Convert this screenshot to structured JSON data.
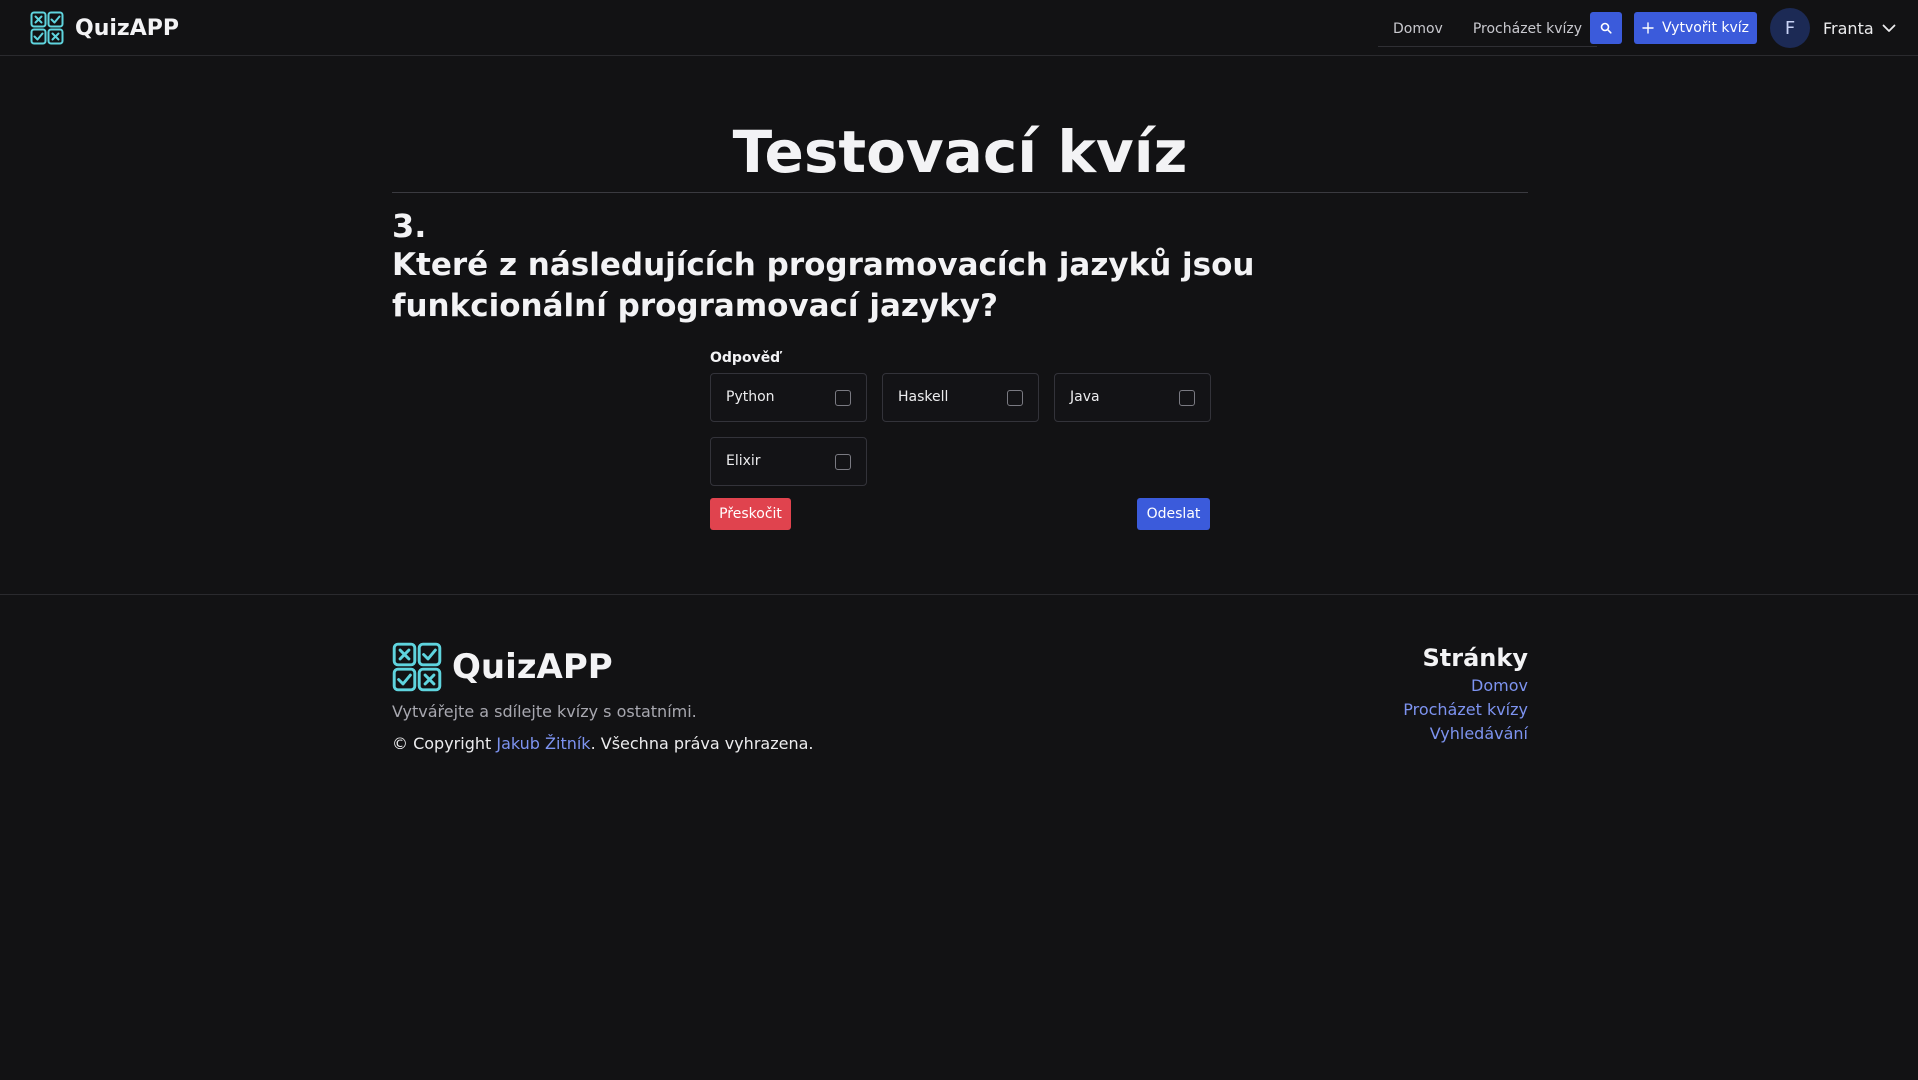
{
  "brand": {
    "name": "QuizAPP",
    "accent": "#5fd4de"
  },
  "nav": {
    "links": [
      "Domov",
      "Procházet kvízy"
    ],
    "search_icon": "search-icon",
    "create_label": "Vytvořit kvíz",
    "user": {
      "initial": "F",
      "name": "Franta"
    }
  },
  "quiz": {
    "title": "Testovací kvíz",
    "question_number": "3.",
    "question_text": "Které z následujících programovacích jazyků jsou funkcionální programovací jazyky?",
    "answer_label": "Odpověď",
    "options": [
      {
        "label": "Python",
        "checked": false
      },
      {
        "label": "Haskell",
        "checked": false
      },
      {
        "label": "Java",
        "checked": false
      },
      {
        "label": "Elixir",
        "checked": false
      }
    ],
    "skip_label": "Přeskočit",
    "submit_label": "Odeslat"
  },
  "footer": {
    "brand_name": "QuizAPP",
    "tagline": "Vytvářejte a sdílejte kvízy s ostatními.",
    "copyright_prefix": "© Copyright ",
    "author": "Jakub Žitník",
    "copyright_suffix": ". Všechna práva vyhrazena.",
    "pages_heading": "Stránky",
    "pages": [
      "Domov",
      "Procházet kvízy",
      "Vyhledávání"
    ]
  },
  "colors": {
    "background": "#121214",
    "primary": "#3b5bdb",
    "danger": "#e0434e",
    "link": "#7d93f0"
  }
}
